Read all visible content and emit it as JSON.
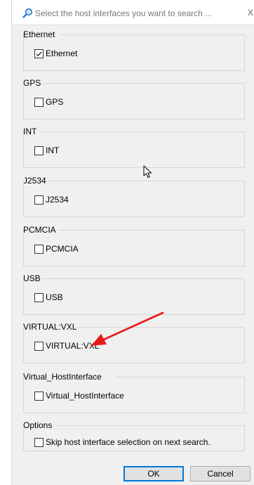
{
  "search": {
    "placeholder": "Select the host interfaces you want to search ...",
    "clear_label": "X"
  },
  "groups": [
    {
      "title": "Ethernet",
      "option": "Ethernet",
      "checked": true
    },
    {
      "title": "GPS",
      "option": "GPS",
      "checked": false
    },
    {
      "title": "INT",
      "option": "INT",
      "checked": false
    },
    {
      "title": "J2534",
      "option": "J2534",
      "checked": false
    },
    {
      "title": "PCMCIA",
      "option": "PCMCIA",
      "checked": false
    },
    {
      "title": "USB",
      "option": "USB",
      "checked": false
    },
    {
      "title": "VIRTUAL:VXL",
      "option": "VIRTUAL:VXL",
      "checked": false
    },
    {
      "title": "Virtual_HostInterface",
      "option": "Virtual_HostInterface",
      "checked": false
    }
  ],
  "options": {
    "title": "Options",
    "skip_label": "Skip host interface selection on next search.",
    "skip_checked": false
  },
  "buttons": {
    "ok": "OK",
    "cancel": "Cancel"
  },
  "colors": {
    "dialog_bg": "#f0f0f0",
    "group_border": "#d6d6d6",
    "default_button_border": "#0078d7",
    "annotation_arrow": "#e81b1b"
  },
  "icons": {
    "search": "magnifier-icon",
    "cursor": "mouse-pointer-icon",
    "annotation": "red-arrow-icon"
  }
}
